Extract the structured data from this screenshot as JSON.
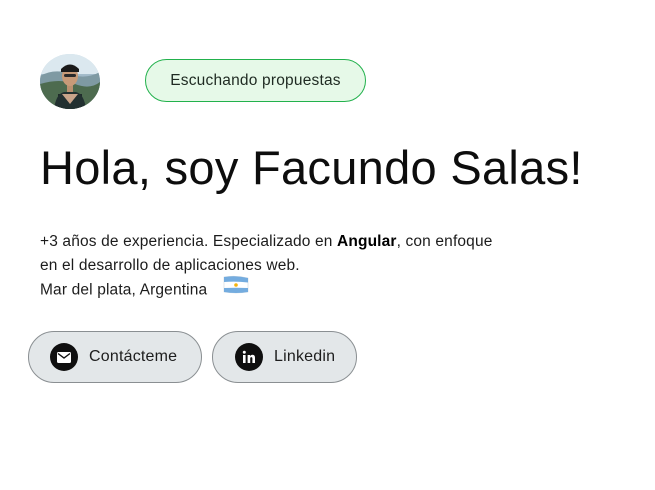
{
  "profile": {
    "avatar_alt": "avatar",
    "status": "Escuchando propuestas",
    "status_colors": {
      "border": "#22b14c",
      "background": "#e6f9e8"
    }
  },
  "hero": {
    "title": "Hola, soy Facundo Salas!"
  },
  "bio": {
    "line1_before": "+3 años de experiencia. Especializado en ",
    "line1_highlight": "Angular",
    "line1_after": ", con enfoque",
    "line2": "en el desarrollo de aplicaciones web.",
    "location": "Mar del plata, Argentina",
    "flag_icon": "argentina-flag-icon"
  },
  "actions": {
    "contact_label": "Contácteme",
    "contact_icon": "mail-icon",
    "linkedin_label": "Linkedin",
    "linkedin_icon": "linkedin-icon"
  }
}
